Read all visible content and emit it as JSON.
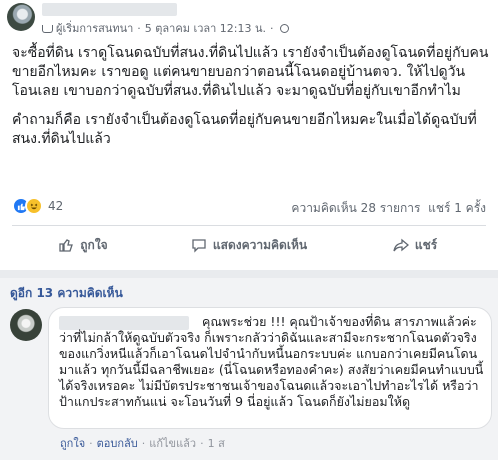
{
  "post": {
    "author_badge": "ผู้เริ่มการสนทนา",
    "separator": "·",
    "timestamp": "5 ตุลาคม เวลา 12:13 น.",
    "paragraphs": [
      "จะซื้อที่ดิน เราดูโฉนดฉบับที่สนง.ที่ดินไปแล้ว เรายังจำเป็นต้องดูโฉนดที่อยู่กับคนขายอีกไหมคะ เราขอดู แต่คนขายบอกว่าตอนนี้โฉนดอยู่บ้านตจว. ให้ไปดูวันโอนเลย เขาบอกว่าดูฉบับที่สนง.ที่ดินไปแล้ว จะมาดูฉบับที่อยู่กับเขาอีกทำไม",
      "คำถามก็คือ เรายังจำเป็นต้องดูโฉนดที่อยู่กับคนขายอีกไหมคะในเมื่อได้ดูฉบับที่สนง.ที่ดินไปแล้ว"
    ],
    "reaction_count": "42",
    "comments_count": "ความคิดเห็น 28 รายการ",
    "shares_count": "แชร์ 1 ครั้ง",
    "actions": {
      "like": "ถูกใจ",
      "comment": "แสดงความคิดเห็น",
      "share": "แชร์"
    }
  },
  "comments_section": {
    "view_more": "ดูอีก 13 ความคิดเห็น",
    "comment": {
      "lead": "คุณพระช่วย !!! คุณป้าเจ้าของที่ดิน",
      "body": "สารภาพแล้วค่ะว่าที่ไม่กล้าให้ดูฉบับตัวจริง ก็เพราะกลัวว่าดิฉันและสามีจะกระชากโฉนดตัวจริงของแกวิ่งหนีแล้วก็เอาโฉนดไปจำนำกับหนี้นอกระบบค่ะ แกบอกว่าเคยมีคนโดนมาแล้ว ทุกวันนี้มีฉลาชีพเยอะ (นี่โฉนดหรือทองคำคะ) สงสัยว่าเคยมีคนทำแบบนี้ได้จริงเหรอคะ ไม่มีบัตรประชาชนเจ้าของโฉนดแล้วจะเอาไปทำอะไรได้ หรือว่าป้าแกประสาทกันแน่ จะโอนวันที่ 9 นี่อยู่แล้ว โฉนดก็ยังไม่ยอมให้ดู",
      "like": "ถูกใจ",
      "reply": "ตอบกลับ",
      "hide": "แก้ไขแล้ว",
      "time": "1 ส"
    }
  }
}
